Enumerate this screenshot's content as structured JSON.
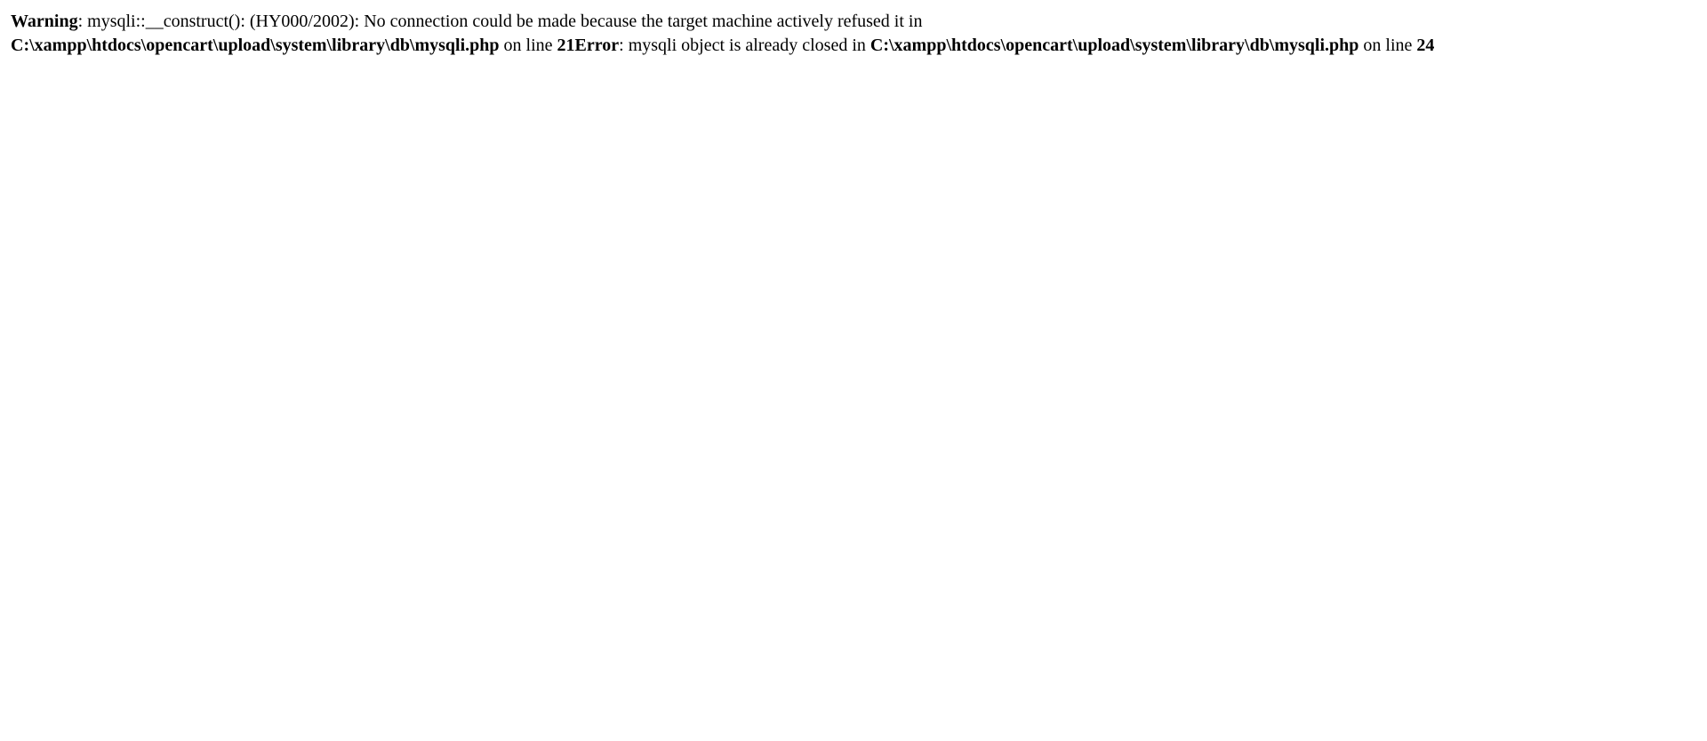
{
  "page": {
    "background_color": "#ffffff",
    "text_color": "#000000"
  },
  "warning": {
    "label": "Warning",
    "message": ": mysqli::__construct(): (HY000/2002): No connection could be made because the target machine actively refused it in ",
    "file": "C:\\xampp\\htdocs\\opencart\\upload\\system\\library\\db\\mysqli.php",
    "on_line_text": " on line ",
    "line": "21"
  },
  "error": {
    "label": "Error",
    "message": ": mysqli object is already closed in ",
    "file": "C:\\xampp\\htdocs\\opencart\\upload\\system\\library\\db\\mysqli.php",
    "on_line_text": " on line ",
    "line": "24"
  }
}
